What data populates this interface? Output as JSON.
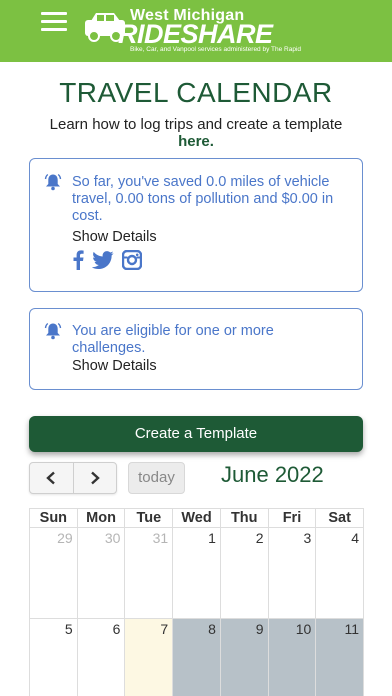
{
  "header": {
    "logo_top": "West Michigan",
    "logo_main": "RIDESHARE",
    "logo_sub": "Bike, Car, and Vanpool services administered by The Rapid",
    "menu_icon": "hamburger-menu-icon"
  },
  "page": {
    "title": "TRAVEL CALENDAR",
    "learn_text": "Learn how to log trips and create a template",
    "learn_link": "here."
  },
  "savings_card": {
    "text": "So far, you've saved 0.0 miles of vehicle travel, 0.00 tons of pollution and $0.00 in cost.",
    "details": "Show Details",
    "icon": "bell-icon",
    "social": [
      "facebook-icon",
      "twitter-icon",
      "instagram-icon"
    ]
  },
  "challenge_card": {
    "text": "You are eligible for one or more challenges.",
    "details": "Show Details",
    "icon": "bell-icon"
  },
  "actions": {
    "create_template": "Create a Template"
  },
  "calendar": {
    "prev_icon": "chevron-left-icon",
    "next_icon": "chevron-right-icon",
    "today_label": "today",
    "month_title": "June 2022",
    "weekdays": [
      "Sun",
      "Mon",
      "Tue",
      "Wed",
      "Thu",
      "Fri",
      "Sat"
    ],
    "week1": [
      "29",
      "30",
      "31",
      "1",
      "2",
      "3",
      "4"
    ],
    "week2": [
      "5",
      "6",
      "7",
      "8",
      "9",
      "10",
      "11"
    ]
  },
  "colors": {
    "header_green": "#7cc142",
    "dark_green": "#1e5a36",
    "card_border_blue": "#6a8fd0",
    "card_text_blue": "#4a76c9",
    "today_highlight": "#fdf8e3",
    "past_day_gray": "#b7c1c8"
  }
}
